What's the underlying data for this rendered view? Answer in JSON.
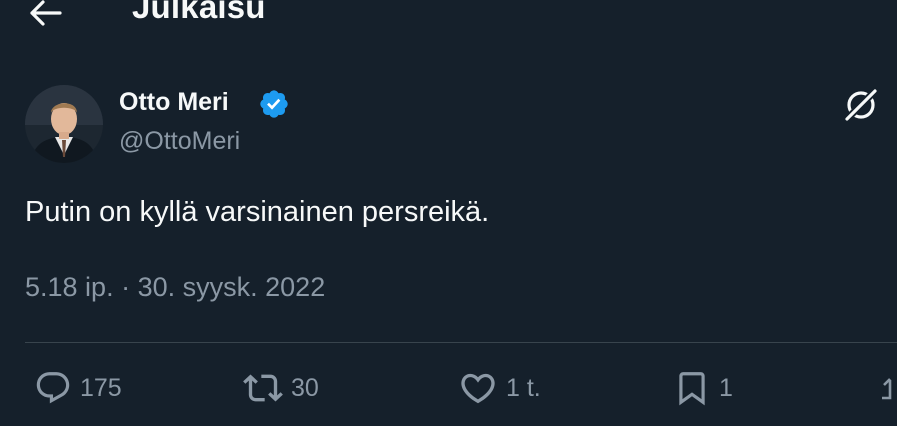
{
  "header": {
    "title": "Julkaisu"
  },
  "author": {
    "name": "Otto Meri",
    "handle": "@OttoMeri",
    "verified": true
  },
  "post": {
    "text": "Putin on kyllä varsinainen persreikä.",
    "time": "5.18 ip.",
    "separator": "·",
    "date": "30. syysk. 2022"
  },
  "actions": {
    "replies": "175",
    "reposts": "30",
    "likes": "1 t.",
    "bookmarks": "1"
  },
  "icons": {
    "back": "arrow-left-icon",
    "verified": "verified-badge-icon",
    "grok": "grok-icon",
    "reply": "comment-icon",
    "retweet": "retweet-icon",
    "like": "heart-icon",
    "bookmark": "bookmark-icon",
    "share": "share-icon"
  },
  "colors": {
    "background": "#15202b",
    "text": "#f7f9f9",
    "secondary_text": "#8b98a5",
    "verified": "#1d9bf0",
    "divider": "#38444d"
  }
}
